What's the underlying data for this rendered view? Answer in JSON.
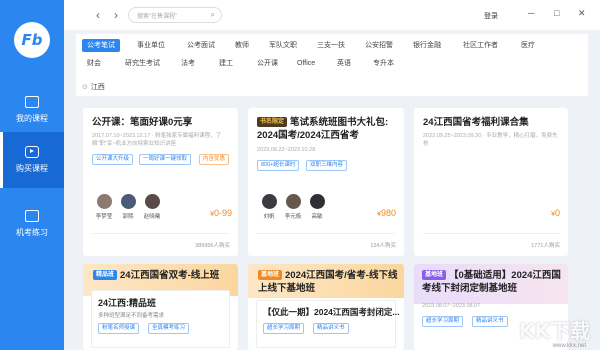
{
  "logo": {
    "text": "Fb"
  },
  "sidebar": {
    "items": [
      {
        "label": "我的课程",
        "icon": "book-icon"
      },
      {
        "label": "购买课程",
        "icon": "play-icon"
      },
      {
        "label": "机考练习",
        "icon": "computer-icon"
      }
    ]
  },
  "topbar": {
    "search_placeholder": "搜索\"在售课程\"",
    "login_label": "登录",
    "back": "‹",
    "forward": "›",
    "minimize": "─",
    "maximize": "□",
    "close": "✕"
  },
  "categories": {
    "row1": [
      "公考笔试",
      "事业单位",
      "公考面试",
      "教师",
      "军队文职",
      "三支一扶",
      "公安招警",
      "银行金融",
      "社区工作者",
      "医疗"
    ],
    "row2": [
      "财会",
      "研究生考试",
      "法考",
      "建工",
      "公开课",
      "Office",
      "英语",
      "专升本"
    ],
    "active": "公考笔试"
  },
  "location": "江西",
  "cards": [
    {
      "title": "公开课：笔面好课0元享",
      "date": "2017.07.10~2023.12.17 · 粉笔独家专属福利课程，了解\"职\"享~机业方向探索业知识讲座",
      "tags": [
        "公开课大升级",
        "一周好课一键领取",
        "内含优惠"
      ],
      "teachers": [
        "李梦莹",
        "郭熙",
        "赵晓曦"
      ],
      "price": "0-99",
      "buyers": "389956人购买"
    },
    {
      "badge": "书名限定",
      "title": "笔试系统班图书大礼包: 2024国考/2024江西省考",
      "date": "2023.08.22~2023.10.28",
      "tags": [
        "800+超长课时",
        "双职三维内容"
      ],
      "teachers": [
        "刘帆",
        "李元极",
        "高敏"
      ],
      "price": "980",
      "buyers": "124人购买"
    },
    {
      "title": "24江西国省考福利课合集",
      "date": "2022.09.25~2023.09.30 · 专业教学，精心打磨，免费先抢",
      "tags": [],
      "teachers": [],
      "price": "0",
      "buyers": "1771人购买"
    }
  ],
  "bottom_cards": [
    {
      "badge": "精品班",
      "title": "24江西国省双考-线上班",
      "inner_title": "24江西:精品班",
      "inner_desc": "多种班型满足不同备考需求",
      "tags": [
        "粉笔名师授课",
        "全真模考练习"
      ]
    },
    {
      "badge": "基地班",
      "title": "2024江西国考/省考-线下线上线下基地班",
      "inner_title": "【仅此一期】2024江西国考封闭定...",
      "tags": [
        "超长学习周期",
        "精品讲义书"
      ],
      "badge_color": "#f08a20"
    },
    {
      "badge": "基地班",
      "title": "【0基础适用】2024江西国考线下封闭定制基地班",
      "date": "2023.08.07~2023.08.07",
      "tags": [
        "超长学习周期",
        "精品讲义书"
      ]
    }
  ],
  "watermark": {
    "text": "KK下载",
    "url": "www.kkx.net"
  }
}
